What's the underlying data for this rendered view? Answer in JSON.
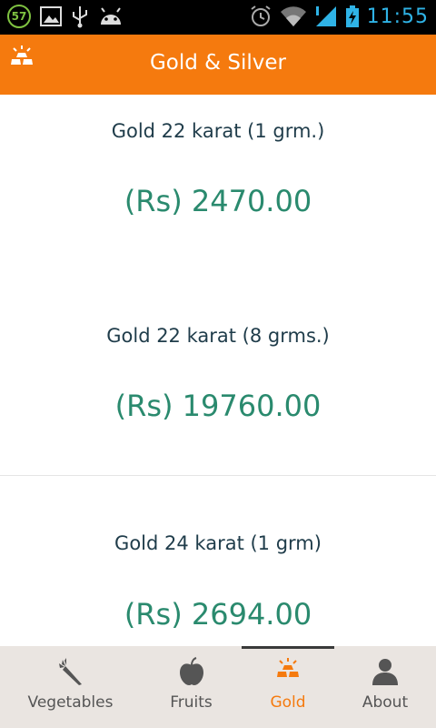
{
  "status_bar": {
    "badge": "57",
    "time": "11:55"
  },
  "app_bar": {
    "title": "Gold & Silver",
    "accent_color": "#f57a0e",
    "logo_icon": "gold-bars-icon"
  },
  "prices": [
    {
      "name": "Gold 22 karat (1 grm.)",
      "value": "(Rs) 2470.00"
    },
    {
      "name": "Gold 22 karat (8 grms.)",
      "value": "(Rs) 19760.00"
    },
    {
      "name": "Gold 24 karat (1 grm)",
      "value": "(Rs) 2694.00"
    }
  ],
  "bottom_nav": {
    "items": [
      {
        "label": "Vegetables",
        "icon": "carrot-icon"
      },
      {
        "label": "Fruits",
        "icon": "apple-icon"
      },
      {
        "label": "Gold",
        "icon": "gold-bars-icon",
        "active": true
      },
      {
        "label": "About",
        "icon": "person-icon"
      }
    ]
  },
  "colors": {
    "price_value": "#2a8a6e",
    "price_name": "#1f3c4a",
    "nav_background": "#eae5e1",
    "status_icons": "#2fb3e6"
  }
}
